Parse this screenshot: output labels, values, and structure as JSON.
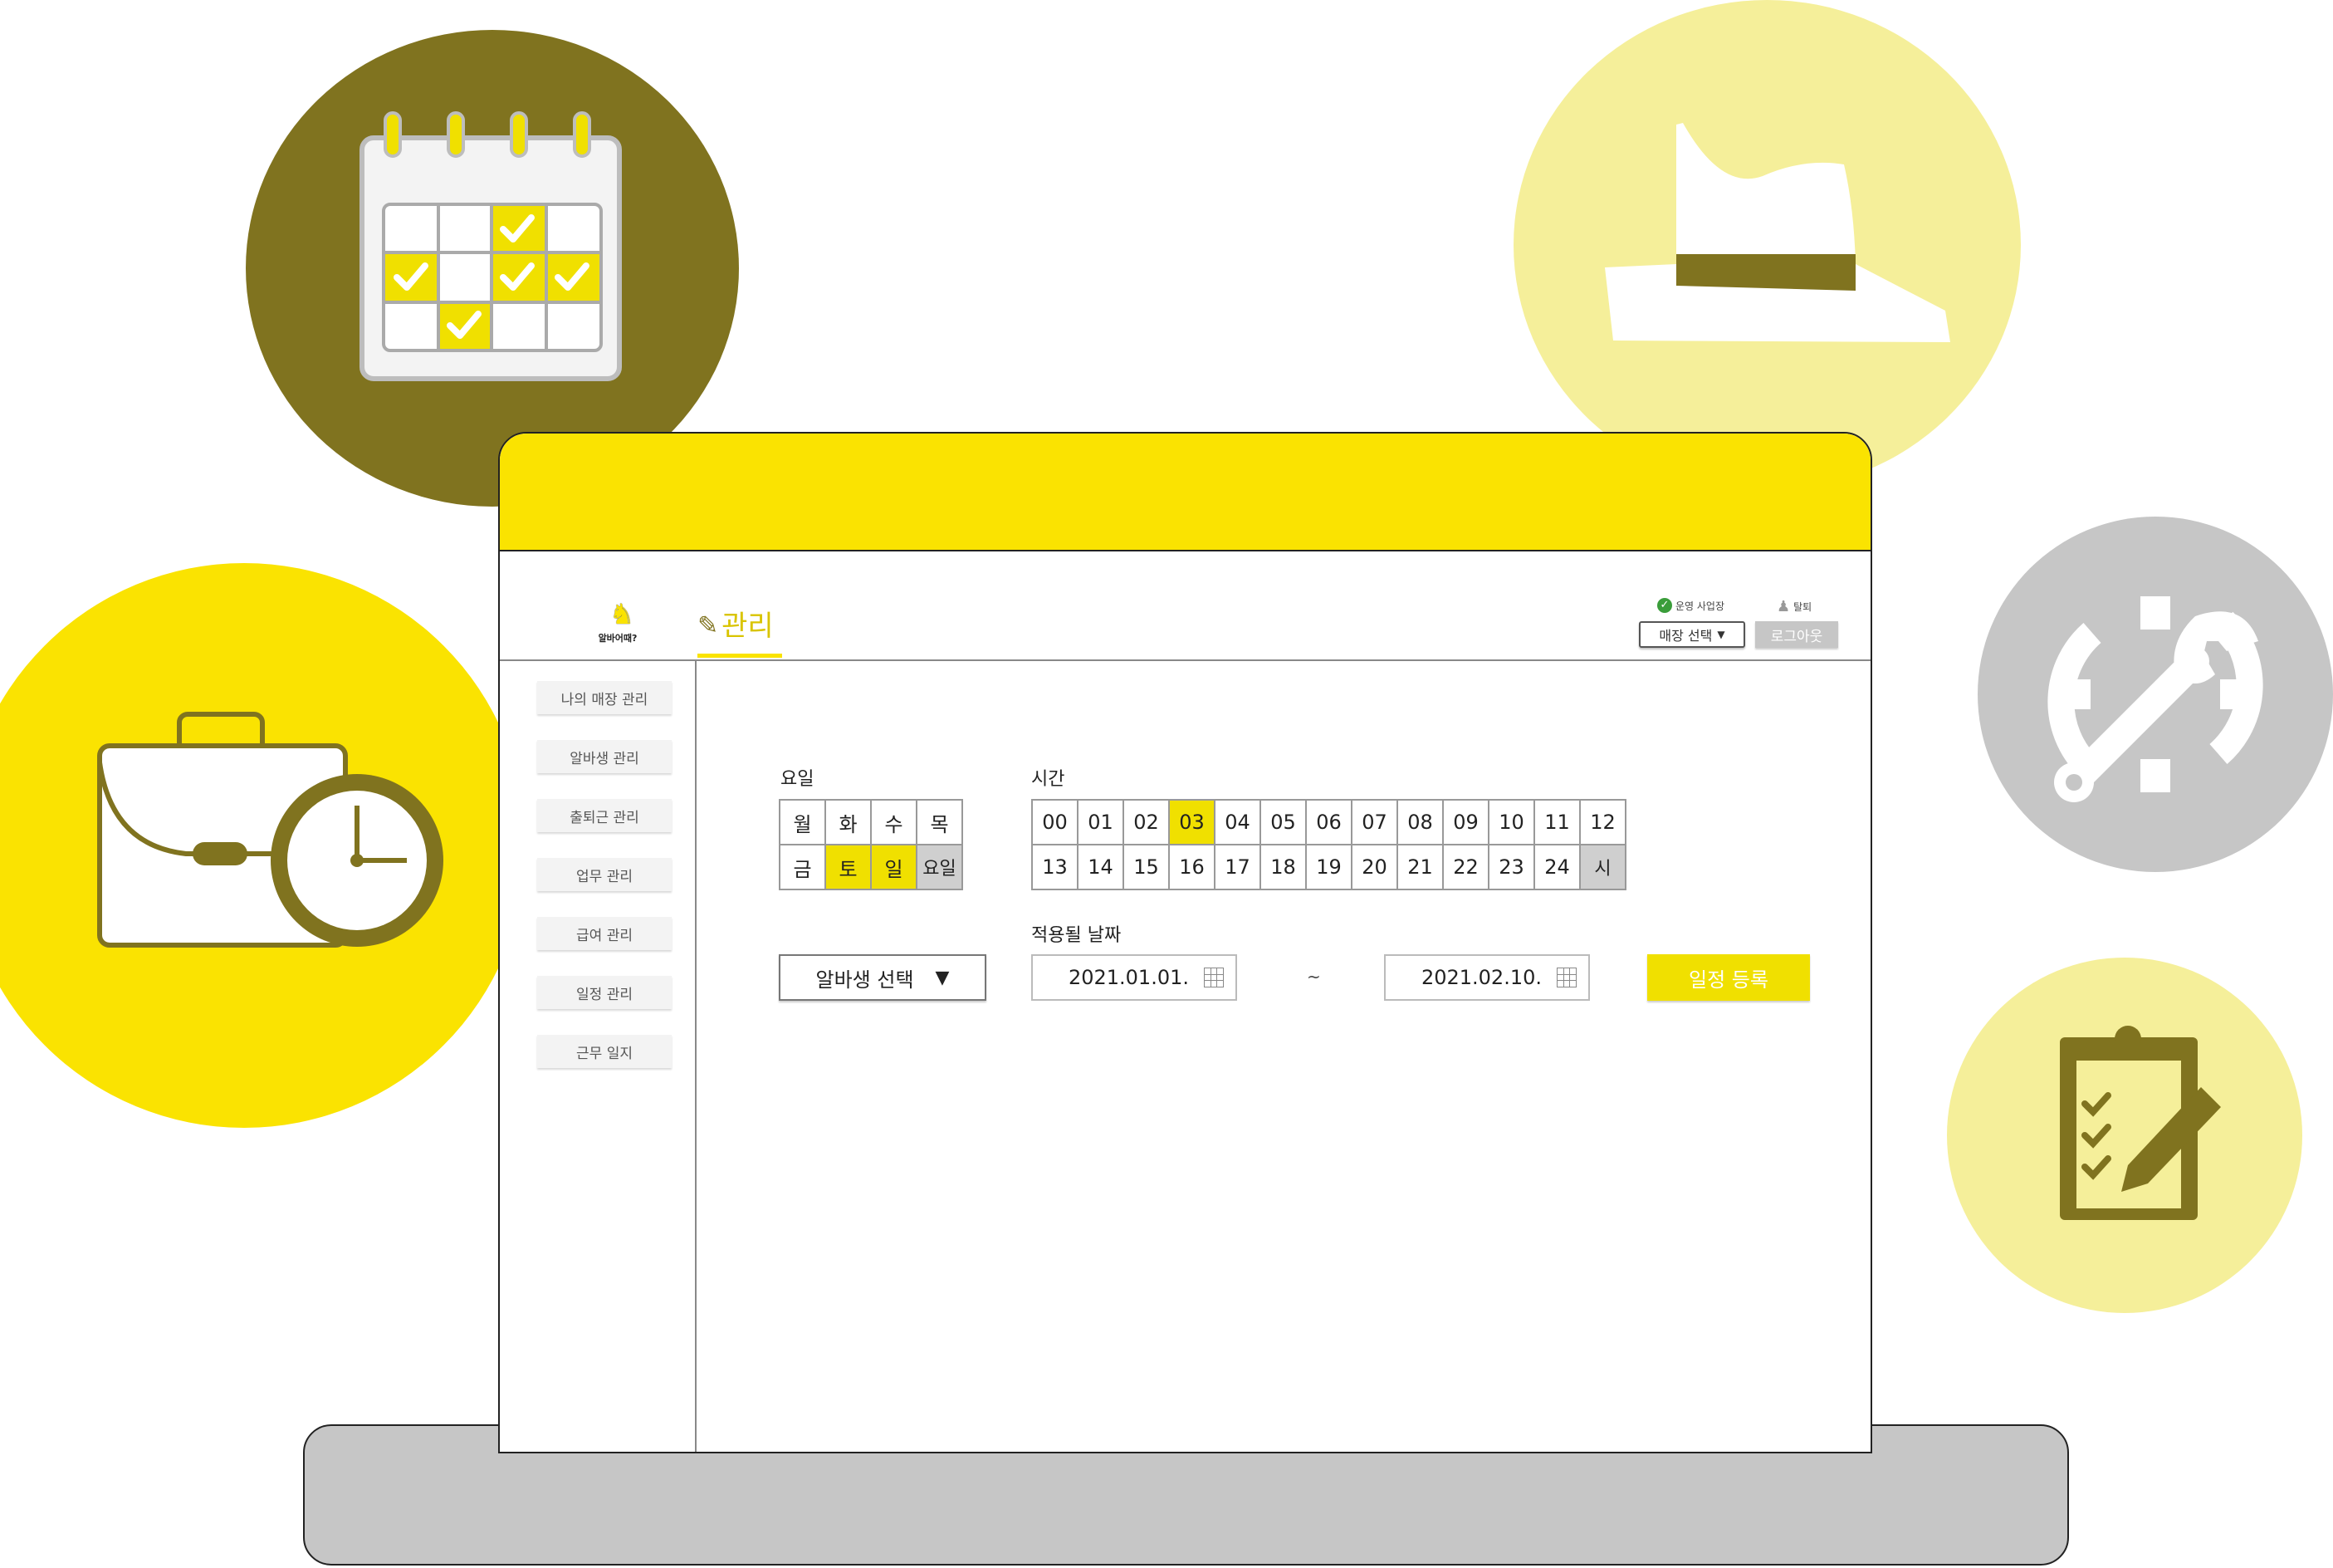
{
  "header": {
    "logo_text": "알바어때?",
    "page_title": "관리",
    "store_status": "운영 사업장",
    "withdraw_label": "탈퇴",
    "store_select": "매장 선택",
    "logout": "로그아웃"
  },
  "sidebar": {
    "items": [
      {
        "label": "나의 매장 관리"
      },
      {
        "label": "알바생 관리"
      },
      {
        "label": "출퇴근 관리"
      },
      {
        "label": "업무 관리"
      },
      {
        "label": "급여 관리"
      },
      {
        "label": "일정 관리"
      },
      {
        "label": "근무 일지"
      }
    ]
  },
  "schedule": {
    "days_label": "요일",
    "days_row1": [
      "월",
      "화",
      "수",
      "목"
    ],
    "days_row2": [
      "금",
      "토",
      "일",
      "요일"
    ],
    "selected_days": [
      "토",
      "일"
    ],
    "time_label": "시간",
    "hours_row1": [
      "00",
      "01",
      "02",
      "03",
      "04",
      "05",
      "06",
      "07",
      "08",
      "09",
      "10",
      "11",
      "12"
    ],
    "hours_row2": [
      "13",
      "14",
      "15",
      "16",
      "17",
      "18",
      "19",
      "20",
      "21",
      "22",
      "23",
      "24",
      "시"
    ],
    "selected_hours": [
      "03"
    ],
    "date_label": "적용될 날짜",
    "alba_select": "알바생 선택",
    "start_date": "2021.01.01.",
    "range_sep": "~",
    "end_date": "2021.02.10.",
    "register": "일정 등록"
  },
  "colors": {
    "accent_yellow": "#fae301",
    "olive": "#80731f",
    "light_yellow": "#f5ef9a",
    "gray": "#c6c6c6"
  },
  "decor_icons": [
    "calendar-icon",
    "hat-icon",
    "briefcase-clock-icon",
    "gear-wrench-icon",
    "clipboard-pencil-icon"
  ]
}
